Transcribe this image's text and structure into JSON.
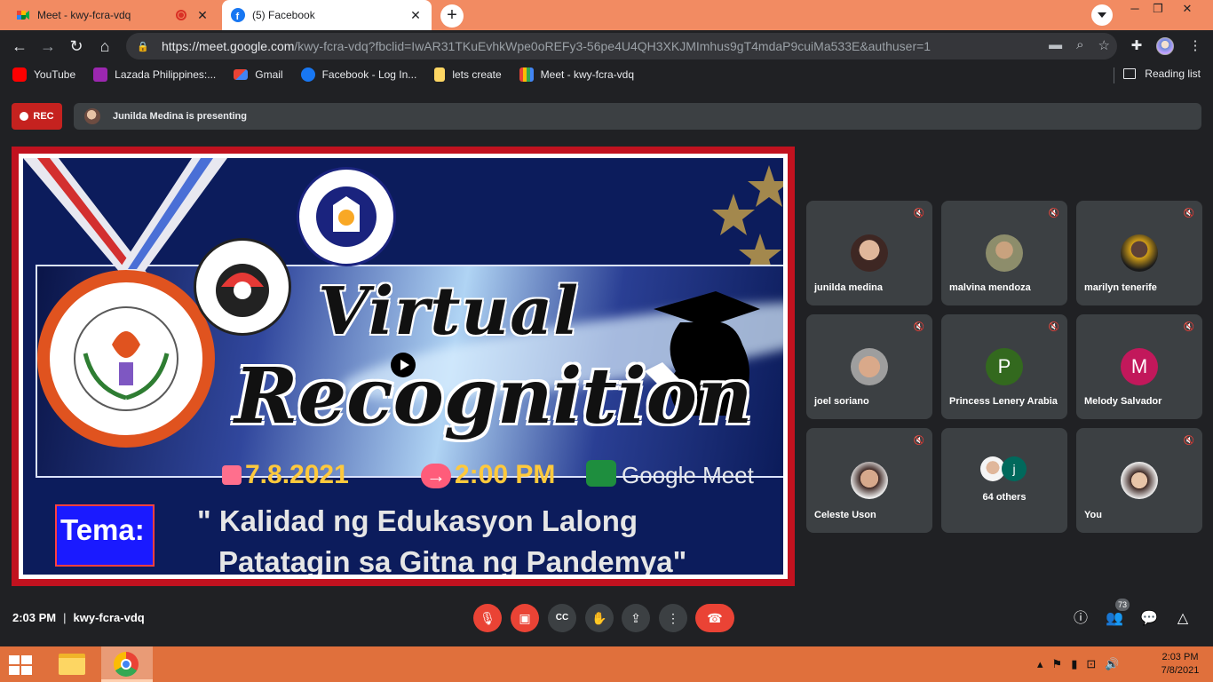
{
  "browser": {
    "tabs": [
      {
        "title": "Meet - kwy-fcra-vdq",
        "icon": "google-meet-icon",
        "recording": true
      },
      {
        "title": "(5) Facebook",
        "icon": "facebook-icon",
        "active": true
      }
    ],
    "url_host": "https://meet.google.com",
    "url_path": "/kwy-fcra-vdq?fbclid=IwAR31TKuEvhkWpe0oREFy3-56pe4U4QH3XKJMImhus9gT4mdaP9cuiMa533E&authuser=1",
    "bookmarks": [
      {
        "label": "YouTube",
        "icon": "youtube-icon",
        "color": "#ff0000"
      },
      {
        "label": "Lazada Philippines:...",
        "icon": "lazada-icon",
        "color": "#9c27b0"
      },
      {
        "label": "Gmail",
        "icon": "gmail-icon",
        "color": "#ea4335"
      },
      {
        "label": "Facebook - Log In...",
        "icon": "facebook-icon",
        "color": "#1877f2"
      },
      {
        "label": "lets create",
        "icon": "folder-icon",
        "color": "#fdd663"
      },
      {
        "label": "Meet - kwy-fcra-vdq",
        "icon": "google-meet-icon",
        "color": "#34a853"
      }
    ],
    "reading_list": "Reading list"
  },
  "meet": {
    "rec_label": "REC",
    "presenting_text": "Junilda Medina is presenting",
    "slide": {
      "title_line1": "Virtual",
      "title_line2": "Recognition",
      "date": "7.8.2021",
      "time": "2:00 PM",
      "platform": "Google Meet",
      "tema_label": "Tema:",
      "theme_line1": "\" Kalidad ng Edukasyon Lalong",
      "theme_line2": "Patatagin sa Gitna ng Pandemya\""
    },
    "participants": [
      {
        "name": "junilda medina",
        "type": "photo",
        "color": "#c49a7a"
      },
      {
        "name": "malvina mendoza",
        "type": "photo",
        "color": "#a08060"
      },
      {
        "name": "marilyn tenerife",
        "type": "photo",
        "color": "#d4a017"
      },
      {
        "name": "joel soriano",
        "type": "photo",
        "color": "#c7a07e"
      },
      {
        "name": "Princess Lenery Arabia",
        "type": "letter",
        "letter": "P",
        "color": "#33691e"
      },
      {
        "name": "Melody Salvador",
        "type": "letter",
        "letter": "M",
        "color": "#c2185b"
      },
      {
        "name": "Celeste Uson",
        "type": "photo",
        "color": "#8d6e63"
      },
      {
        "name": "64 others",
        "type": "others",
        "letter": "j",
        "color": "#00695c"
      },
      {
        "name": "You",
        "type": "photo",
        "color": "#a1887f"
      }
    ],
    "clock": "2:03 PM",
    "meeting_code": "kwy-fcra-vdq",
    "people_count": "73"
  },
  "taskbar": {
    "time": "2:03 PM",
    "date": "7/8/2021"
  }
}
